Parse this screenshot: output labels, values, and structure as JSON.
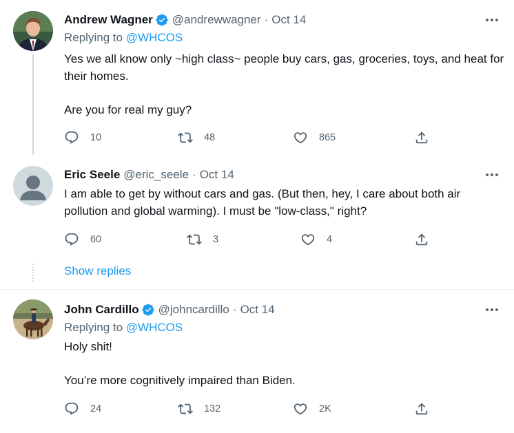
{
  "tweets": [
    {
      "name": "Andrew Wagner",
      "handle": "@andrewwagner",
      "date": "Oct 14",
      "verified": true,
      "replying_prefix": "Replying to",
      "replying_to": "@WHCOS",
      "paragraphs": [
        "Yes we all know only ~high class~ people buy cars, gas, groceries, toys, and heat for their homes.",
        "Are you for real my guy?"
      ],
      "replies": "10",
      "retweets": "48",
      "likes": "865"
    },
    {
      "name": "Eric Seele",
      "handle": "@eric_seele",
      "date": "Oct 14",
      "verified": false,
      "paragraphs": [
        "I am able to get by without cars and gas.  (But then, hey, I care about both air pollution and global warming).  I must be \"low-class,\" right?"
      ],
      "replies": "60",
      "retweets": "3",
      "likes": "4"
    },
    {
      "name": "John Cardillo",
      "handle": "@johncardillo",
      "date": "Oct 14",
      "verified": true,
      "replying_prefix": "Replying to",
      "replying_to": "@WHCOS",
      "paragraphs": [
        "Holy shit!",
        "You’re more cognitively impaired than Biden."
      ],
      "replies": "24",
      "retweets": "132",
      "likes": "2K"
    }
  ],
  "show_replies_label": "Show replies",
  "dot": "·",
  "icons": {
    "reply": "reply-icon",
    "retweet": "retweet-icon",
    "like": "heart-icon",
    "share": "share-icon",
    "verified": "verified-badge-icon",
    "more": "more-options-icon"
  },
  "colors": {
    "text": "#0f1419",
    "secondary": "#536471",
    "accent": "#1d9bf0",
    "thread_line": "#cfd9de",
    "divider": "#eff3f4"
  }
}
